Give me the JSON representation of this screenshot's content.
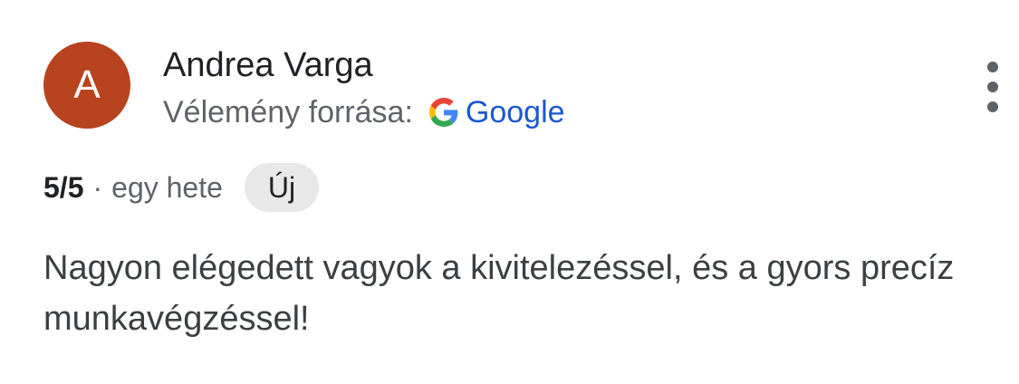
{
  "review": {
    "avatar_initial": "A",
    "avatar_color": "#b8431f",
    "author_name": "Andrea Varga",
    "source_label": "Vélemény forrása:",
    "source_name": "Google",
    "source_icon": "google-g-icon",
    "rating": "5/5",
    "separator": "·",
    "time_ago": "egy hete",
    "badge": "Új",
    "text": "Nagyon elégedett vagyok a kivitelezéssel, és a gyors precíz munkavégzéssel!",
    "menu_icon": "more-vert-icon"
  },
  "colors": {
    "link": "#1a57d6",
    "secondary_text": "#5f6368",
    "badge_bg": "#e8e8e8"
  }
}
